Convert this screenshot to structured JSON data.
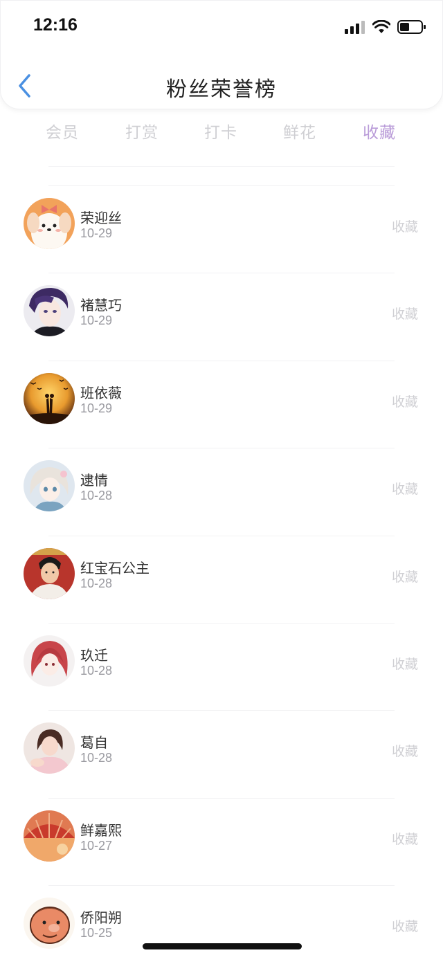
{
  "status_bar": {
    "time": "12:16"
  },
  "header": {
    "title": "粉丝荣誉榜"
  },
  "tabs": [
    {
      "label": "会员",
      "active": false
    },
    {
      "label": "打赏",
      "active": false
    },
    {
      "label": "打卡",
      "active": false
    },
    {
      "label": "鲜花",
      "active": false
    },
    {
      "label": "收藏",
      "active": true
    }
  ],
  "colors": {
    "active_tab": "#b99bd8",
    "inactive_tab": "#cfcfd3",
    "back_arrow": "#4a90e2"
  },
  "fans": [
    {
      "name": "荣迎丝",
      "date": "10-29",
      "action": "收藏",
      "avatar": "cartoon-dog-avatar"
    },
    {
      "name": "褚慧巧",
      "date": "10-29",
      "action": "收藏",
      "avatar": "anime-boy-avatar"
    },
    {
      "name": "班依薇",
      "date": "10-29",
      "action": "收藏",
      "avatar": "sunset-couple-avatar"
    },
    {
      "name": "逮情",
      "date": "10-28",
      "action": "收藏",
      "avatar": "anime-girl-avatar"
    },
    {
      "name": "红宝石公主",
      "date": "10-28",
      "action": "收藏",
      "avatar": "costume-girl-avatar"
    },
    {
      "name": "玖迁",
      "date": "10-28",
      "action": "收藏",
      "avatar": "red-hair-girl-avatar"
    },
    {
      "name": "葛自",
      "date": "10-28",
      "action": "收藏",
      "avatar": "girl-photo-avatar"
    },
    {
      "name": "鲜嘉熙",
      "date": "10-27",
      "action": "收藏",
      "avatar": "red-umbrella-avatar"
    },
    {
      "name": "侨阳朔",
      "date": "10-25",
      "action": "收藏",
      "avatar": "cartoon-face-avatar"
    }
  ]
}
